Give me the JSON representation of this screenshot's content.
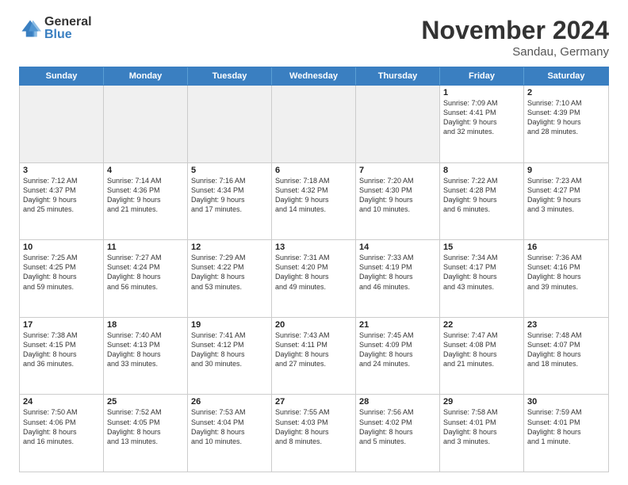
{
  "logo": {
    "general": "General",
    "blue": "Blue"
  },
  "title": "November 2024",
  "location": "Sandau, Germany",
  "header_days": [
    "Sunday",
    "Monday",
    "Tuesday",
    "Wednesday",
    "Thursday",
    "Friday",
    "Saturday"
  ],
  "weeks": [
    [
      {
        "day": "",
        "info": ""
      },
      {
        "day": "",
        "info": ""
      },
      {
        "day": "",
        "info": ""
      },
      {
        "day": "",
        "info": ""
      },
      {
        "day": "",
        "info": ""
      },
      {
        "day": "1",
        "info": "Sunrise: 7:09 AM\nSunset: 4:41 PM\nDaylight: 9 hours\nand 32 minutes."
      },
      {
        "day": "2",
        "info": "Sunrise: 7:10 AM\nSunset: 4:39 PM\nDaylight: 9 hours\nand 28 minutes."
      }
    ],
    [
      {
        "day": "3",
        "info": "Sunrise: 7:12 AM\nSunset: 4:37 PM\nDaylight: 9 hours\nand 25 minutes."
      },
      {
        "day": "4",
        "info": "Sunrise: 7:14 AM\nSunset: 4:36 PM\nDaylight: 9 hours\nand 21 minutes."
      },
      {
        "day": "5",
        "info": "Sunrise: 7:16 AM\nSunset: 4:34 PM\nDaylight: 9 hours\nand 17 minutes."
      },
      {
        "day": "6",
        "info": "Sunrise: 7:18 AM\nSunset: 4:32 PM\nDaylight: 9 hours\nand 14 minutes."
      },
      {
        "day": "7",
        "info": "Sunrise: 7:20 AM\nSunset: 4:30 PM\nDaylight: 9 hours\nand 10 minutes."
      },
      {
        "day": "8",
        "info": "Sunrise: 7:22 AM\nSunset: 4:28 PM\nDaylight: 9 hours\nand 6 minutes."
      },
      {
        "day": "9",
        "info": "Sunrise: 7:23 AM\nSunset: 4:27 PM\nDaylight: 9 hours\nand 3 minutes."
      }
    ],
    [
      {
        "day": "10",
        "info": "Sunrise: 7:25 AM\nSunset: 4:25 PM\nDaylight: 8 hours\nand 59 minutes."
      },
      {
        "day": "11",
        "info": "Sunrise: 7:27 AM\nSunset: 4:24 PM\nDaylight: 8 hours\nand 56 minutes."
      },
      {
        "day": "12",
        "info": "Sunrise: 7:29 AM\nSunset: 4:22 PM\nDaylight: 8 hours\nand 53 minutes."
      },
      {
        "day": "13",
        "info": "Sunrise: 7:31 AM\nSunset: 4:20 PM\nDaylight: 8 hours\nand 49 minutes."
      },
      {
        "day": "14",
        "info": "Sunrise: 7:33 AM\nSunset: 4:19 PM\nDaylight: 8 hours\nand 46 minutes."
      },
      {
        "day": "15",
        "info": "Sunrise: 7:34 AM\nSunset: 4:17 PM\nDaylight: 8 hours\nand 43 minutes."
      },
      {
        "day": "16",
        "info": "Sunrise: 7:36 AM\nSunset: 4:16 PM\nDaylight: 8 hours\nand 39 minutes."
      }
    ],
    [
      {
        "day": "17",
        "info": "Sunrise: 7:38 AM\nSunset: 4:15 PM\nDaylight: 8 hours\nand 36 minutes."
      },
      {
        "day": "18",
        "info": "Sunrise: 7:40 AM\nSunset: 4:13 PM\nDaylight: 8 hours\nand 33 minutes."
      },
      {
        "day": "19",
        "info": "Sunrise: 7:41 AM\nSunset: 4:12 PM\nDaylight: 8 hours\nand 30 minutes."
      },
      {
        "day": "20",
        "info": "Sunrise: 7:43 AM\nSunset: 4:11 PM\nDaylight: 8 hours\nand 27 minutes."
      },
      {
        "day": "21",
        "info": "Sunrise: 7:45 AM\nSunset: 4:09 PM\nDaylight: 8 hours\nand 24 minutes."
      },
      {
        "day": "22",
        "info": "Sunrise: 7:47 AM\nSunset: 4:08 PM\nDaylight: 8 hours\nand 21 minutes."
      },
      {
        "day": "23",
        "info": "Sunrise: 7:48 AM\nSunset: 4:07 PM\nDaylight: 8 hours\nand 18 minutes."
      }
    ],
    [
      {
        "day": "24",
        "info": "Sunrise: 7:50 AM\nSunset: 4:06 PM\nDaylight: 8 hours\nand 16 minutes."
      },
      {
        "day": "25",
        "info": "Sunrise: 7:52 AM\nSunset: 4:05 PM\nDaylight: 8 hours\nand 13 minutes."
      },
      {
        "day": "26",
        "info": "Sunrise: 7:53 AM\nSunset: 4:04 PM\nDaylight: 8 hours\nand 10 minutes."
      },
      {
        "day": "27",
        "info": "Sunrise: 7:55 AM\nSunset: 4:03 PM\nDaylight: 8 hours\nand 8 minutes."
      },
      {
        "day": "28",
        "info": "Sunrise: 7:56 AM\nSunset: 4:02 PM\nDaylight: 8 hours\nand 5 minutes."
      },
      {
        "day": "29",
        "info": "Sunrise: 7:58 AM\nSunset: 4:01 PM\nDaylight: 8 hours\nand 3 minutes."
      },
      {
        "day": "30",
        "info": "Sunrise: 7:59 AM\nSunset: 4:01 PM\nDaylight: 8 hours\nand 1 minute."
      }
    ]
  ]
}
